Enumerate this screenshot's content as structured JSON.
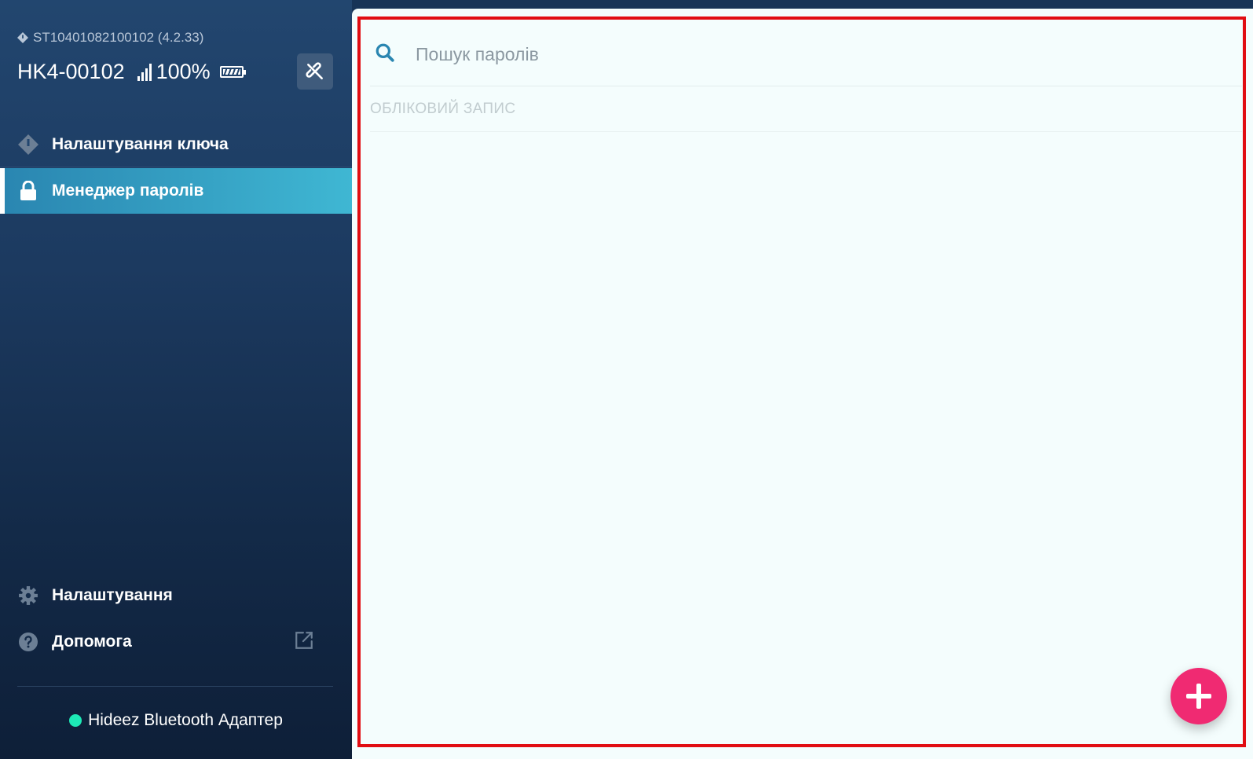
{
  "device": {
    "serial": "ST10401082100102 (4.2.33)",
    "name": "HK4-00102",
    "battery_percent": "100%"
  },
  "nav": {
    "key_settings": "Налаштування ключа",
    "password_manager": "Менеджер паролів",
    "settings": "Налаштування",
    "help": "Допомога"
  },
  "adapter": {
    "label": "Hideez Bluetooth Адаптер",
    "status_color": "#1de9b6"
  },
  "main": {
    "search_placeholder": "Пошук паролів",
    "search_value": "",
    "column_header": "ОБЛІКОВИЙ ЗАПИС"
  },
  "colors": {
    "accent_active": "#3fb7d3",
    "fab": "#f02a72",
    "highlight_frame": "#e10d12"
  },
  "icons": {
    "serial": "diamond-icon",
    "signal": "signal-icon",
    "battery": "battery-icon",
    "unlink": "unlink-icon",
    "key_settings": "diamond-info-icon",
    "password_manager": "lock-icon",
    "settings": "gear-icon",
    "help": "question-icon",
    "external": "external-link-icon",
    "search": "search-icon",
    "add": "plus-icon"
  }
}
